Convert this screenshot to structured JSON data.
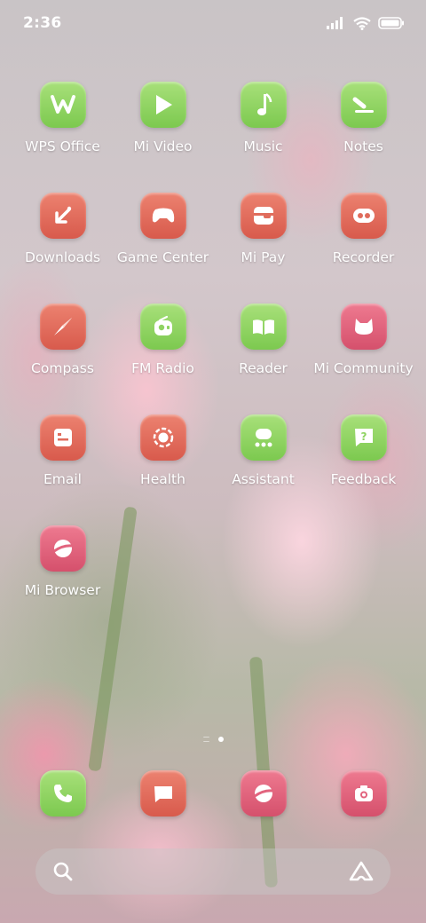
{
  "status_bar": {
    "time": "2:36"
  },
  "apps": [
    {
      "label": "WPS Office",
      "icon": "wps-office-icon",
      "color": "green"
    },
    {
      "label": "Mi Video",
      "icon": "play-icon",
      "color": "green"
    },
    {
      "label": "Music",
      "icon": "music-note-icon",
      "color": "green"
    },
    {
      "label": "Notes",
      "icon": "notes-pen-icon",
      "color": "green"
    },
    {
      "label": "Downloads",
      "icon": "download-arrow-icon",
      "color": "red"
    },
    {
      "label": "Game Center",
      "icon": "gamepad-icon",
      "color": "red"
    },
    {
      "label": "Mi Pay",
      "icon": "wallet-icon",
      "color": "red"
    },
    {
      "label": "Recorder",
      "icon": "recorder-icon",
      "color": "red"
    },
    {
      "label": "Compass",
      "icon": "compass-needle-icon",
      "color": "red"
    },
    {
      "label": "FM Radio",
      "icon": "radio-icon",
      "color": "green"
    },
    {
      "label": "Reader",
      "icon": "book-icon",
      "color": "green"
    },
    {
      "label": "Mi Community",
      "icon": "community-bunny-icon",
      "color": "pink"
    },
    {
      "label": "Email",
      "icon": "email-icon",
      "color": "red"
    },
    {
      "label": "Health",
      "icon": "health-ring-icon",
      "color": "red"
    },
    {
      "label": "Assistant",
      "icon": "assistant-icon",
      "color": "green"
    },
    {
      "label": "Feedback",
      "icon": "feedback-question-icon",
      "color": "green"
    },
    {
      "label": "Mi Browser",
      "icon": "browser-planet-icon",
      "color": "pink"
    }
  ],
  "page_indicator": {
    "pages": 2,
    "active": 2
  },
  "dock": [
    {
      "icon": "phone-icon",
      "color": "green"
    },
    {
      "icon": "messages-icon",
      "color": "red"
    },
    {
      "icon": "browser-planet-icon",
      "color": "pink"
    },
    {
      "icon": "camera-icon",
      "color": "pink"
    }
  ],
  "colors": {
    "green": "#8fd362",
    "red": "#e06c5c",
    "pink": "#e2647e",
    "text": "#ffffff"
  }
}
